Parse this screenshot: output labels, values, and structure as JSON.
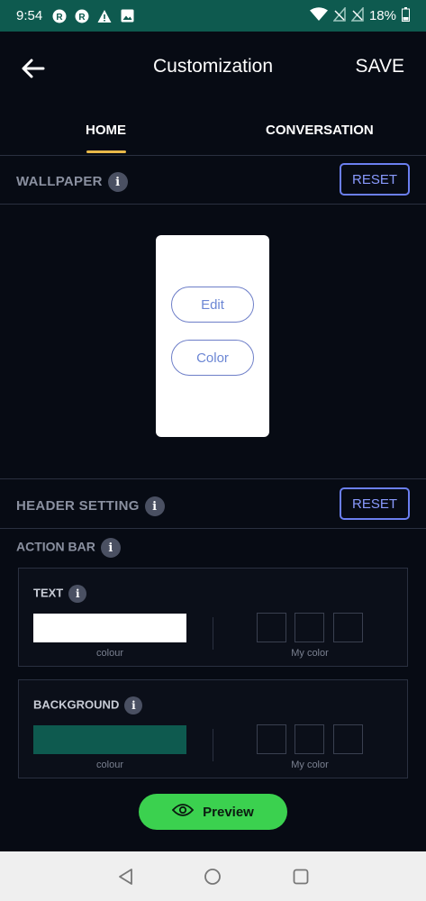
{
  "status_bar": {
    "time": "9:54",
    "battery": "18%",
    "left_icons": [
      "app-notification-icon",
      "app-notification-icon",
      "warning-icon",
      "image-icon"
    ],
    "right_icons": [
      "wifi-icon",
      "no-signal-icon",
      "no-signal-icon",
      "battery-icon"
    ]
  },
  "header": {
    "title": "Customization",
    "save_label": "SAVE"
  },
  "tabs": [
    {
      "label": "HOME",
      "active": true
    },
    {
      "label": "CONVERSATION",
      "active": false
    }
  ],
  "wallpaper": {
    "label": "WALLPAPER",
    "reset_label": "RESET",
    "edit_label": "Edit",
    "color_label": "Color"
  },
  "header_setting": {
    "label": "HEADER SETTING",
    "reset_label": "RESET"
  },
  "action_bar": {
    "label": "ACTION BAR",
    "text_card": {
      "label": "TEXT",
      "colour_caption": "colour",
      "my_color_caption": "My color",
      "selected_color": "#ffffff"
    },
    "background_card": {
      "label": "BACKGROUND",
      "colour_caption": "colour",
      "my_color_caption": "My color",
      "selected_color": "#0e5a4f"
    }
  },
  "preview": {
    "label": "Preview"
  },
  "colors": {
    "accent": "#6b7ff0",
    "status_bar": "#0e5a4f",
    "tab_indicator": "#e9b949",
    "preview_button": "#3bd14f"
  }
}
